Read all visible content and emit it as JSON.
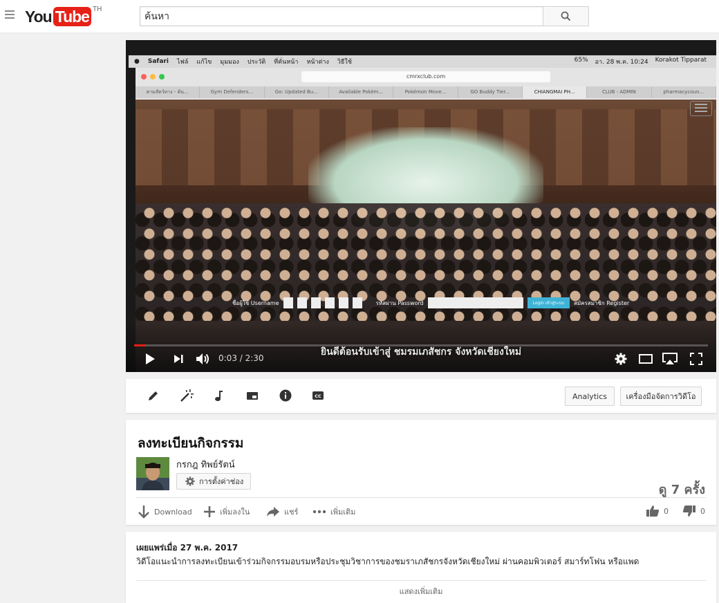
{
  "masthead": {
    "logo_you": "You",
    "logo_tube": "Tube",
    "region": "TH",
    "search_placeholder": "ค้นหา"
  },
  "player": {
    "current_time": "0:03",
    "duration": "2:30",
    "time_display": "0:03 / 2:30",
    "progress_fraction": 0.02,
    "progress_color": "#e62117",
    "frame": {
      "menubar_left": [
        "Safari",
        "ไฟล์",
        "แก้ไข",
        "มุมมอง",
        "ประวัติ",
        "ที่คั่นหน้า",
        "หน้าต่าง",
        "วิธีใช้"
      ],
      "menubar_right": [
        "65%",
        "อา. 28 พ.ค. 10:24",
        "Korakot Tipparat"
      ],
      "url": "cmrxclub.com",
      "browser_tabs": [
        "ตามสัตว์ทาง - ค้น...",
        "Gym Defenders...",
        "Go: Updated Bu...",
        "Available Pokém...",
        "Pokémon Move...",
        "GO Buddy Tier...",
        "CHIANGMAI PH...",
        "CLUB - ADMIN",
        "pharmacycoun..."
      ],
      "login_username_label": "ชื่อผู้ใช้  Username",
      "login_password_label": "รหัสผ่าน  Password",
      "login_button": "Login เข้าสู่ระบบ",
      "register_label": "สมัครสมาชิก Register",
      "caption": "ยินดีต้อนรับเข้าสู่ ชมรมเภสัชกร จังหวัดเชียงใหม่"
    }
  },
  "toolbar": {
    "analytics_label": "Analytics",
    "video_manager_label": "เครื่องมือจัดการวิดีโอ"
  },
  "video": {
    "title": "ลงทะเบียนกิจกรรม",
    "channel_name": "กรกฎ ทิพย์รัตน์",
    "channel_settings_label": "การตั้งค่าช่อง",
    "views": "ดู 7 ครั้ง",
    "actions": {
      "download": "Download",
      "add_to": "เพิ่มลงใน",
      "share": "แชร์",
      "more": "เพิ่มเติม"
    },
    "likes": "0",
    "dislikes": "0"
  },
  "description": {
    "published": "เผยแพร่เมื่อ 27 พ.ค. 2017",
    "text": "วิดีโอแนะนำการลงทะเบียนเข้าร่วมกิจกรรมอบรมหรือประชุมวิชาการของชมราเภสัชกรจังหวัดเชียงใหม่ ผ่านคอมพิวเตอร์ สมาร์ทโฟน หรือแพด",
    "show_more": "แสดงเพิ่มเติม"
  }
}
